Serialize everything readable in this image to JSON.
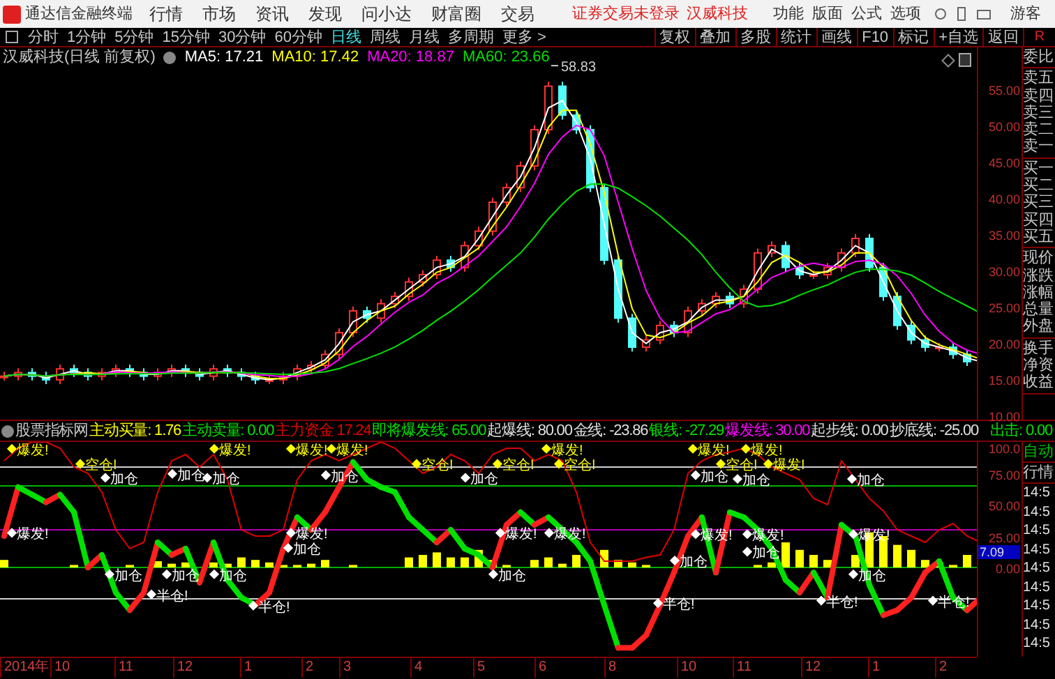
{
  "app": {
    "name": "通达信金融终端",
    "menu": [
      "行情",
      "市场",
      "资讯",
      "发现",
      "问小达",
      "财富圈",
      "交易"
    ],
    "notices": [
      "证券交易未登录",
      "汉威科技"
    ],
    "tools": [
      "功能",
      "版面",
      "公式",
      "选项"
    ],
    "user": "游客"
  },
  "periods": [
    {
      "label": "分时",
      "selected": false
    },
    {
      "label": "1分钟",
      "selected": false
    },
    {
      "label": "5分钟",
      "selected": false
    },
    {
      "label": "15分钟",
      "selected": false
    },
    {
      "label": "30分钟",
      "selected": false
    },
    {
      "label": "60分钟",
      "selected": false
    },
    {
      "label": "日线",
      "selected": true
    },
    {
      "label": "周线",
      "selected": false
    },
    {
      "label": "月线",
      "selected": false
    },
    {
      "label": "多周期",
      "selected": false
    },
    {
      "label": "更多 >",
      "selected": false
    }
  ],
  "actions": [
    "复权",
    "叠加",
    "多股",
    "统计",
    "画线",
    "F10",
    "标记",
    "+自选",
    "返回"
  ],
  "corner_label": "R",
  "price_pane": {
    "title": "汉威科技(日线 前复权)",
    "ma": [
      {
        "name": "MA5:",
        "value": "17.21",
        "color": "#ffffff"
      },
      {
        "name": "MA10:",
        "value": "17.42",
        "color": "#ffff00"
      },
      {
        "name": "MA20:",
        "value": "18.87",
        "color": "#ff00ff"
      },
      {
        "name": "MA60:",
        "value": "23.66",
        "color": "#00e000"
      }
    ],
    "peak_label": "58.83",
    "axis_labels": [
      "55.00",
      "50.00",
      "45.00",
      "40.00",
      "35.00",
      "30.00",
      "25.00",
      "20.00",
      "15.00",
      "10.00"
    ]
  },
  "indicator_pane": {
    "title": "股票指标网",
    "readings": [
      {
        "label": "主动买量:",
        "value": "1.76",
        "kind": "volume"
      },
      {
        "label": "主动卖量:",
        "value": "0.00",
        "kind": "signal"
      },
      {
        "label": "主力资金",
        "value": "17.24",
        "kind": "fund"
      },
      {
        "label": "即将爆发线:",
        "value": "65.00",
        "kind": "signal"
      },
      {
        "label": "起爆线:",
        "value": "80.00",
        "kind": "level"
      },
      {
        "label": "金线:",
        "value": "-23.86",
        "kind": "level"
      },
      {
        "label": "银线:",
        "value": "-27.29",
        "kind": "signal"
      },
      {
        "label": "爆发线:",
        "value": "30.00",
        "kind": "burst"
      },
      {
        "label": "起步线:",
        "value": "0.00",
        "kind": "level"
      },
      {
        "label": "抄底线:",
        "value": "-25.00",
        "kind": "level"
      }
    ],
    "attack": {
      "label": "出击:",
      "value": "0.00",
      "kind": "signal"
    },
    "axis_labels": [
      "100.0",
      "75.00",
      "50.00",
      "25.00",
      "0.00"
    ],
    "current_value": "7.09",
    "signals": [
      {
        "text": "爆发!",
        "color": "#ffff00"
      },
      {
        "text": "空仓!",
        "color": "#ffff00"
      },
      {
        "text": "爆发!",
        "color": "#ffff00"
      },
      {
        "text": "爆发!",
        "color": "#ffff00"
      },
      {
        "text": "爆发!",
        "color": "#ffff00"
      },
      {
        "text": "空仓!",
        "color": "#ffff00"
      },
      {
        "text": "空仓!",
        "color": "#ffff00"
      },
      {
        "text": "爆发!",
        "color": "#ffff00"
      },
      {
        "text": "空仓!",
        "color": "#ffff00"
      },
      {
        "text": "爆发!",
        "color": "#ffff00"
      },
      {
        "text": "空仓!",
        "color": "#ffff00"
      },
      {
        "text": "爆发!",
        "color": "#ffff00"
      },
      {
        "text": "爆发!",
        "color": "#ffff00"
      },
      {
        "text": "加仓",
        "color": "#ffffff"
      },
      {
        "text": "加仓",
        "color": "#ffffff"
      },
      {
        "text": "加仓",
        "color": "#ffffff"
      },
      {
        "text": "加仓",
        "color": "#ffffff"
      },
      {
        "text": "加仓",
        "color": "#ffffff"
      },
      {
        "text": "加仓",
        "color": "#ffffff"
      },
      {
        "text": "加仓",
        "color": "#ffffff"
      },
      {
        "text": "加仓",
        "color": "#ffffff"
      },
      {
        "text": "爆发!",
        "color": "#ffffff"
      },
      {
        "text": "爆发!",
        "color": "#ffffff"
      },
      {
        "text": "爆发!",
        "color": "#ffffff"
      },
      {
        "text": "爆发!",
        "color": "#ffffff"
      },
      {
        "text": "爆发!",
        "color": "#ffffff"
      },
      {
        "text": "爆发!",
        "color": "#ffffff"
      },
      {
        "text": "爆发!",
        "color": "#ffffff"
      },
      {
        "text": "加仓",
        "color": "#ffffff"
      },
      {
        "text": "加仓",
        "color": "#ffffff"
      },
      {
        "text": "加仓",
        "color": "#ffffff"
      },
      {
        "text": "加仓",
        "color": "#ffffff"
      },
      {
        "text": "加仓",
        "color": "#ffffff"
      },
      {
        "text": "加仓",
        "color": "#ffffff"
      },
      {
        "text": "加仓",
        "color": "#ffffff"
      },
      {
        "text": "加仓",
        "color": "#ffffff"
      },
      {
        "text": "半仓!",
        "color": "#ffffff"
      },
      {
        "text": "半仓!",
        "color": "#ffffff"
      },
      {
        "text": "半仓!",
        "color": "#ffffff"
      },
      {
        "text": "半仓!",
        "color": "#ffffff"
      },
      {
        "text": "半仓!",
        "color": "#ffffff"
      }
    ]
  },
  "date_axis": [
    "2014年",
    "10",
    "11",
    "12",
    "1",
    "2",
    "3",
    "4",
    "5",
    "6",
    "8",
    "10",
    "11",
    "12",
    "1",
    "2"
  ],
  "quote_panel": {
    "sections": [
      [
        "委比"
      ],
      [
        "卖五",
        "卖四",
        "卖三",
        "卖二",
        "卖一"
      ],
      [
        "买一",
        "买二",
        "买三",
        "买四",
        "买五"
      ],
      [
        "现价",
        "涨跌",
        "涨幅",
        "总量",
        "外盘"
      ],
      [
        "换手",
        "净资",
        "收益"
      ]
    ],
    "auto": "自动",
    "trades_title": "行情",
    "trade_times": [
      "14:5",
      "14:5",
      "14:5",
      "14:5",
      "14:5",
      "14:5",
      "14:5",
      "14:5",
      "14:5"
    ]
  }
}
